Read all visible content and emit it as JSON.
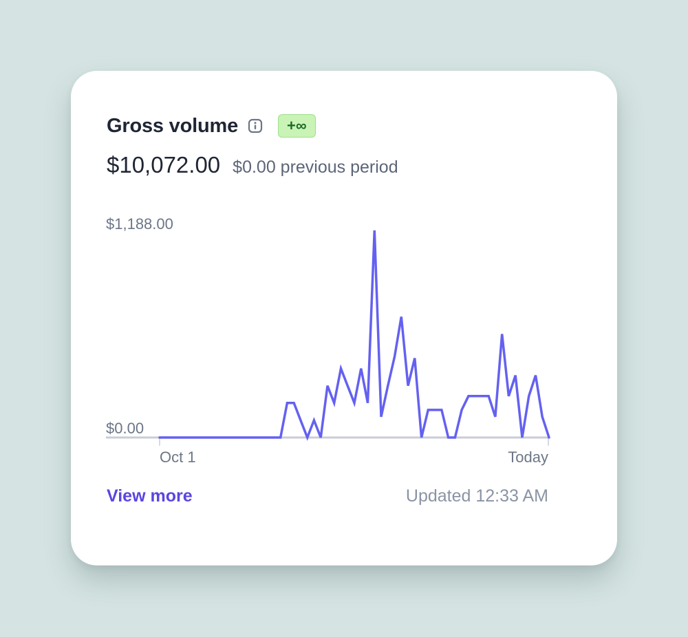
{
  "card": {
    "title": "Gross volume",
    "info_icon": "info-icon",
    "badge": "+∞",
    "amount": "$10,072.00",
    "previous": "$0.00 previous period",
    "view_more": "View more",
    "updated": "Updated 12:33 AM"
  },
  "colors": {
    "line": "#6461f0",
    "accent": "#5b45e0",
    "badge_bg": "#c9f4b6",
    "badge_text": "#1e6b27"
  },
  "chart_data": {
    "type": "line",
    "y_max_label": "$1,188.00",
    "y_min_label": "$0.00",
    "x_start_label": "Oct 1",
    "x_end_label": "Today",
    "ylim": [
      0,
      1188
    ],
    "values": [
      0,
      0,
      0,
      0,
      0,
      0,
      0,
      0,
      0,
      0,
      0,
      0,
      0,
      0,
      0,
      0,
      0,
      0,
      0,
      200,
      200,
      100,
      0,
      100,
      0,
      300,
      200,
      400,
      300,
      200,
      400,
      200,
      1200,
      120,
      300,
      470,
      700,
      300,
      460,
      0,
      160,
      160,
      160,
      0,
      0,
      160,
      240,
      240,
      240,
      240,
      120,
      600,
      240,
      360,
      0,
      240,
      360,
      120,
      0
    ]
  }
}
